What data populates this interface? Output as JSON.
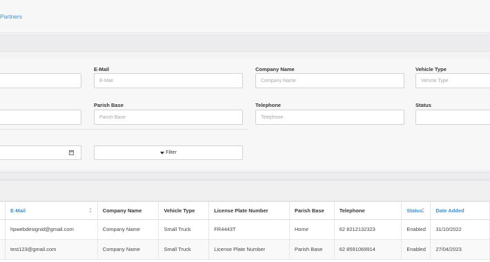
{
  "breadcrumb": {
    "label": "Partners"
  },
  "filters": {
    "email": {
      "label": "E-Mail",
      "placeholder": "E-Mail"
    },
    "company_name": {
      "label": "Company Name",
      "placeholder": "Company Name"
    },
    "vehicle_type": {
      "label": "Vehicle Type",
      "placeholder": "Vehicle Type"
    },
    "parish_base": {
      "label": "Parish Base",
      "placeholder": "Parish Base"
    },
    "telephone": {
      "label": "Telephone",
      "placeholder": "Telephone"
    },
    "status": {
      "label": "Status",
      "value": ""
    },
    "date": {
      "value": "",
      "icon": "calendar-icon"
    },
    "filter_button": {
      "label": "Filter",
      "icon": "filter-icon"
    }
  },
  "table": {
    "columns": [
      {
        "label": "E-Mail",
        "sortable": true
      },
      {
        "label": "Company Name",
        "sortable": false
      },
      {
        "label": "Vehicle Type",
        "sortable": false
      },
      {
        "label": "License Plate Number",
        "sortable": false
      },
      {
        "label": "Parish Base",
        "sortable": false
      },
      {
        "label": "Telephone",
        "sortable": false
      },
      {
        "label": "Status",
        "sortable": true
      },
      {
        "label": "Date Added",
        "sortable": true
      }
    ],
    "rows": [
      [
        "hpwebdesignid@gmail.com",
        "Company Name",
        "Small Truck",
        "FR4443T",
        "Home",
        "62 8212132323",
        "Enabled",
        "31/10/2022"
      ],
      [
        "test123@gmail.com",
        "Company Name",
        "Small Truck",
        "License Plate Number",
        "Parish Base",
        "62 8591069914",
        "Enabled",
        "27/04/2023"
      ]
    ]
  },
  "colors": {
    "link": "#3d8ed6",
    "border": "#cfd2d6",
    "background": "#f3f3f4"
  }
}
